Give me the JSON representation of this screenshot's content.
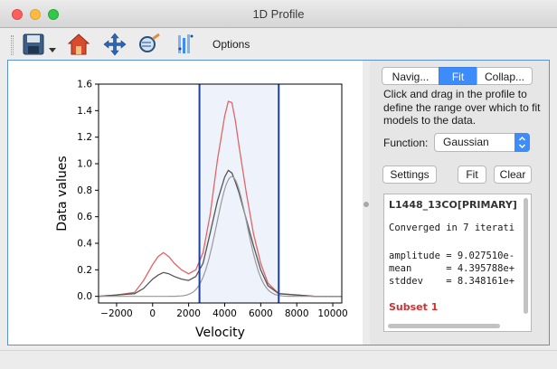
{
  "window": {
    "title": "1D Profile"
  },
  "toolbar": {
    "icons": [
      "save-icon",
      "home-icon",
      "pan-icon",
      "zoom-icon",
      "fit-icon"
    ],
    "options_label": "Options"
  },
  "tabs": [
    {
      "label": "Navig...",
      "active": false
    },
    {
      "label": "Fit",
      "active": true
    },
    {
      "label": "Collap...",
      "active": false
    }
  ],
  "fit_panel": {
    "instructions": "Click and drag in the profile to define the range over which to fit models to the data.",
    "function_label": "Function:",
    "function_value": "Gaussian",
    "settings_label": "Settings",
    "fit_label": "Fit",
    "clear_label": "Clear"
  },
  "results": {
    "title": "L1448_13CO[PRIMARY]",
    "converged": "Converged in 7 iterati",
    "amplitude": "amplitude = 9.027510e-",
    "mean": "mean      = 4.395788e+",
    "stddev": "stddev    = 8.348161e+",
    "subset": "Subset 1"
  },
  "chart_data": {
    "type": "line",
    "xlabel": "Velocity",
    "ylabel": "Data values",
    "xlim": [
      -3000,
      10500
    ],
    "ylim": [
      -0.05,
      1.6
    ],
    "xticks": [
      -2000,
      0,
      2000,
      4000,
      6000,
      8000,
      10000
    ],
    "yticks": [
      0.0,
      0.2,
      0.4,
      0.6,
      0.8,
      1.0,
      1.2,
      1.4,
      1.6
    ],
    "fit_range": [
      2600,
      7000
    ],
    "colors": {
      "data": "#555555",
      "subset": "#e06666",
      "model": "#999999",
      "range": "#1f3fa0",
      "range_fill": "#eef2fb"
    },
    "series": [
      {
        "x": [
          -3000,
          -2000,
          -1000,
          -500,
          0,
          300,
          600,
          900,
          1200,
          1600,
          2000,
          2400,
          2800,
          3200,
          3600,
          4000,
          4200,
          4400,
          4600,
          4800,
          5200,
          5600,
          6000,
          6400,
          7000,
          8000,
          9000,
          10500
        ],
        "y": [
          0.0,
          0.01,
          0.02,
          0.06,
          0.13,
          0.16,
          0.18,
          0.17,
          0.15,
          0.13,
          0.12,
          0.15,
          0.25,
          0.48,
          0.72,
          0.9,
          0.95,
          0.93,
          0.86,
          0.78,
          0.58,
          0.38,
          0.2,
          0.08,
          0.02,
          0.01,
          0.0,
          0.0
        ]
      },
      {
        "x": [
          -3000,
          -2000,
          -1000,
          -500,
          0,
          300,
          600,
          900,
          1200,
          1600,
          2000,
          2400,
          2800,
          3200,
          3600,
          4000,
          4200,
          4400,
          4600,
          4800,
          5200,
          5600,
          6000,
          6400,
          7000,
          8000,
          9000,
          10500
        ],
        "y": [
          0.0,
          0.01,
          0.03,
          0.12,
          0.24,
          0.3,
          0.33,
          0.3,
          0.25,
          0.2,
          0.17,
          0.2,
          0.33,
          0.62,
          1.03,
          1.36,
          1.47,
          1.46,
          1.32,
          1.13,
          0.78,
          0.47,
          0.25,
          0.1,
          0.02,
          0.01,
          0.0,
          0.0
        ]
      },
      {
        "model": true,
        "amplitude": 0.902751,
        "mean": 4395.788,
        "stddev": 834.8161
      }
    ]
  }
}
